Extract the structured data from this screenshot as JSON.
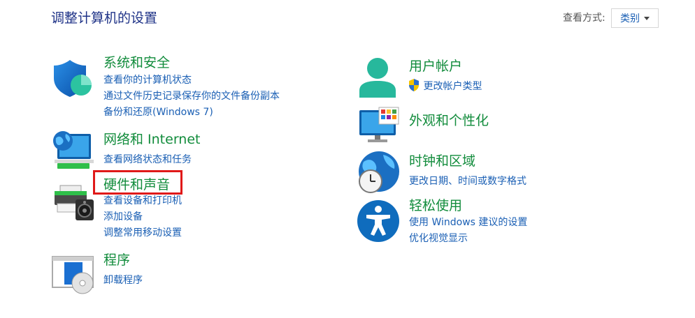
{
  "header": {
    "title": "调整计算机的设置",
    "view_by_label": "查看方式:",
    "view_by_value": "类别"
  },
  "left": [
    {
      "title": "系统和安全",
      "icon": "shield-icon",
      "links": [
        "查看你的计算机状态",
        "通过文件历史记录保存你的文件备份副本",
        "备份和还原(Windows 7)"
      ]
    },
    {
      "title": "网络和 Internet",
      "icon": "network-globe-icon",
      "links": [
        "查看网络状态和任务"
      ]
    },
    {
      "title": "硬件和声音",
      "icon": "printer-speaker-icon",
      "links": [
        "查看设备和打印机",
        "添加设备",
        "调整常用移动设置"
      ]
    },
    {
      "title": "程序",
      "icon": "program-disc-icon",
      "links": [
        "卸载程序"
      ]
    }
  ],
  "right": [
    {
      "title": "用户帐户",
      "icon": "user-icon",
      "links": [
        "更改帐户类型"
      ],
      "link_icon": "uac-shield-icon"
    },
    {
      "title": "外观和个性化",
      "icon": "monitor-palette-icon",
      "links": []
    },
    {
      "title": "时钟和区域",
      "icon": "clock-globe-icon",
      "links": [
        "更改日期、时间或数字格式"
      ]
    },
    {
      "title": "轻松使用",
      "icon": "accessibility-icon",
      "links": [
        "使用 Windows 建议的设置",
        "优化视觉显示"
      ]
    }
  ],
  "colors": {
    "title": "#1e3287",
    "category": "#128c3c",
    "link": "#1a5fb4",
    "highlight": "#e01919"
  }
}
